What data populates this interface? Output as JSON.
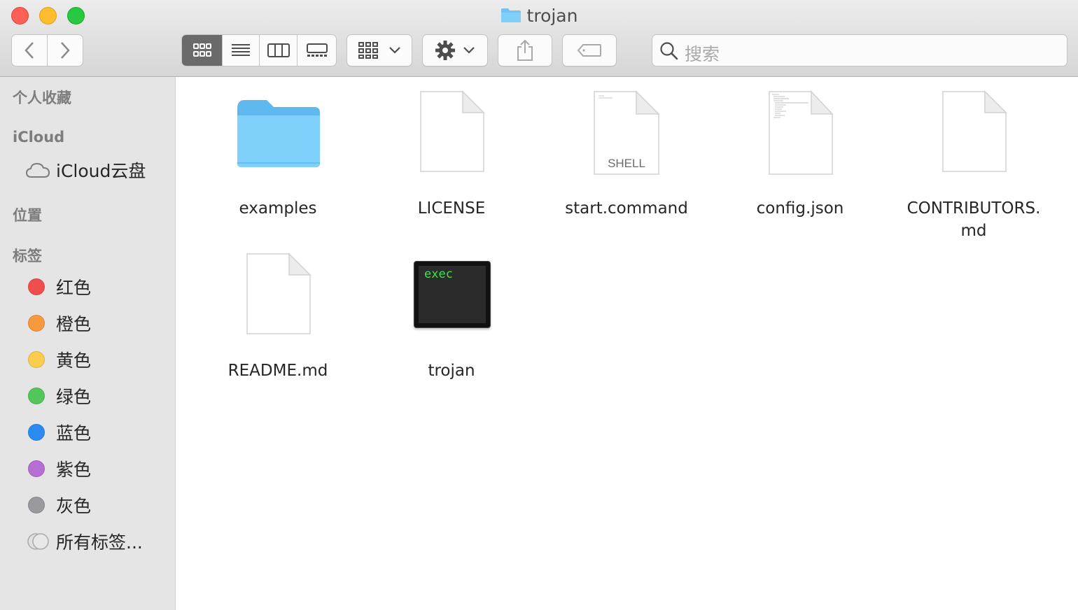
{
  "window": {
    "title": "trojan"
  },
  "toolbar": {
    "search_placeholder": "搜索"
  },
  "sidebar": {
    "favorites_header": "个人收藏",
    "icloud_header": "iCloud",
    "icloud_drive": "iCloud云盘",
    "locations_header": "位置",
    "tags_header": "标签",
    "tags": [
      {
        "label": "红色",
        "color": "#f04e4d"
      },
      {
        "label": "橙色",
        "color": "#f79a3e"
      },
      {
        "label": "黄色",
        "color": "#fbcd4c"
      },
      {
        "label": "绿色",
        "color": "#52c759"
      },
      {
        "label": "蓝色",
        "color": "#2a8bf2"
      },
      {
        "label": "紫色",
        "color": "#b76fd6"
      },
      {
        "label": "灰色",
        "color": "#9a9a9e"
      }
    ],
    "all_tags": "所有标签..."
  },
  "files": [
    {
      "name": "examples",
      "kind": "folder"
    },
    {
      "name": "LICENSE",
      "kind": "document"
    },
    {
      "name": "start.command",
      "kind": "shell",
      "badge": "SHELL"
    },
    {
      "name": "config.json",
      "kind": "text-preview"
    },
    {
      "name": "CONTRIBUTORS.\nmd",
      "kind": "document"
    },
    {
      "name": "README.md",
      "kind": "document"
    },
    {
      "name": "trojan",
      "kind": "executable",
      "badge": "exec"
    }
  ]
}
